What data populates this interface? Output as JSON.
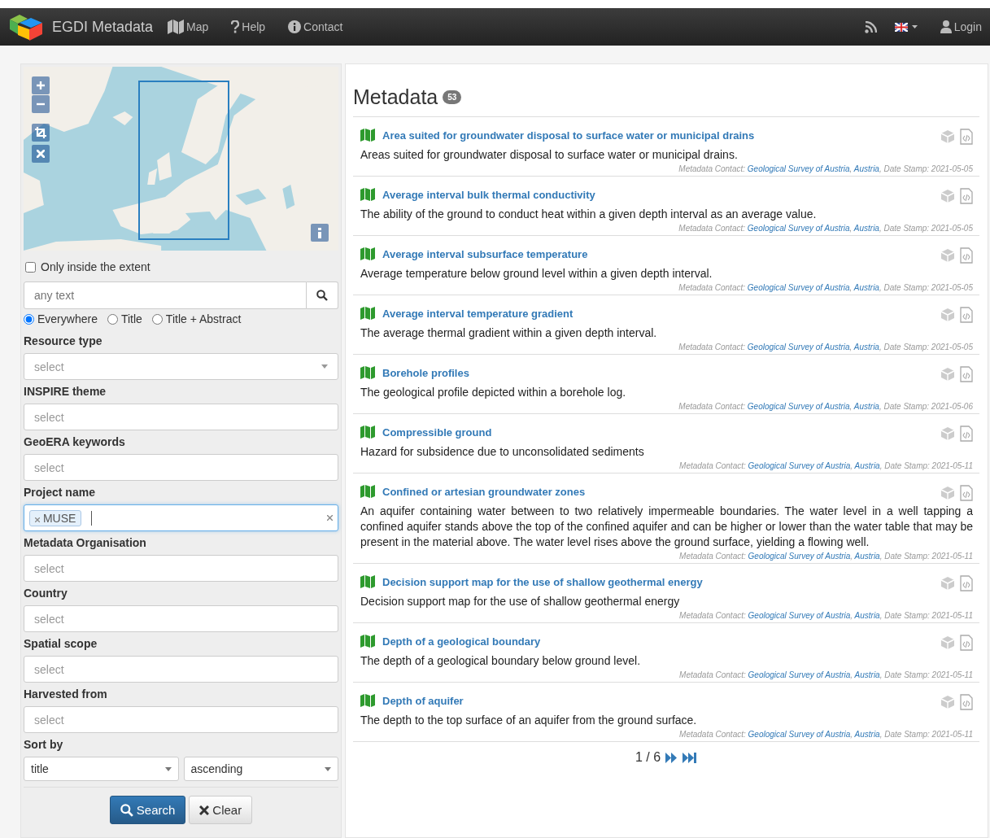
{
  "navbar": {
    "brand": "EGDI Metadata",
    "items": [
      {
        "kind": "map",
        "label": "Map"
      },
      {
        "kind": "help",
        "label": "Help"
      },
      {
        "kind": "info",
        "label": "Contact"
      }
    ],
    "login": "Login"
  },
  "search_panel": {
    "extent": {
      "label": "Only inside the extent",
      "checked": false
    },
    "text_search": {
      "placeholder": "any text"
    },
    "scope": [
      {
        "label": "Everywhere",
        "selected": true
      },
      {
        "label": "Title",
        "selected": false
      },
      {
        "label": "Title + Abstract",
        "selected": false
      }
    ],
    "filters": [
      {
        "label": "Resource type",
        "kind": "dropdown",
        "placeholder": "select"
      },
      {
        "label": "INSPIRE theme",
        "kind": "select",
        "placeholder": "select"
      },
      {
        "label": "GeoERA keywords",
        "kind": "select",
        "placeholder": "select"
      },
      {
        "label": "Project name",
        "kind": "tags",
        "tags": [
          "MUSE"
        ],
        "focused": true
      },
      {
        "label": "Metadata Organisation",
        "kind": "select",
        "placeholder": "select"
      },
      {
        "label": "Country",
        "kind": "select",
        "placeholder": "select"
      },
      {
        "label": "Spatial scope",
        "kind": "select",
        "placeholder": "select"
      },
      {
        "label": "Harvested from",
        "kind": "select",
        "placeholder": "select"
      }
    ],
    "sort": {
      "label": "Sort by",
      "field": "title",
      "order": "ascending"
    },
    "buttons": [
      {
        "kind": "primary",
        "label": "Search"
      },
      {
        "kind": "default",
        "label": "Clear"
      }
    ]
  },
  "results": {
    "title": "Metadata",
    "count": "53",
    "records": [
      {
        "title": "Area suited for groundwater disposal to surface water or municipal drains",
        "description": "Areas suited for groundwater disposal to surface water or municipal drains.",
        "meta": [
          {
            "text": "Metadata Contact: ",
            "link": false
          },
          {
            "text": "Geological Survey of Austria",
            "link": true
          },
          {
            "text": ", ",
            "link": false
          },
          {
            "text": "Austria",
            "link": true
          },
          {
            "text": ", Date Stamp: 2021-05-05",
            "link": false
          }
        ]
      },
      {
        "title": "Average interval bulk thermal conductivity",
        "description": "The ability of the ground to conduct heat within a given depth interval as an average value.",
        "meta": [
          {
            "text": "Metadata Contact: ",
            "link": false
          },
          {
            "text": "Geological Survey of Austria",
            "link": true
          },
          {
            "text": ", ",
            "link": false
          },
          {
            "text": "Austria",
            "link": true
          },
          {
            "text": ", Date Stamp: 2021-05-05",
            "link": false
          }
        ]
      },
      {
        "title": "Average interval subsurface temperature",
        "description": "Average temperature below ground level within a given depth interval.",
        "meta": [
          {
            "text": "Metadata Contact: ",
            "link": false
          },
          {
            "text": "Geological Survey of Austria",
            "link": true
          },
          {
            "text": ", ",
            "link": false
          },
          {
            "text": "Austria",
            "link": true
          },
          {
            "text": ", Date Stamp: 2021-05-05",
            "link": false
          }
        ]
      },
      {
        "title": "Average interval temperature gradient",
        "description": "The average thermal gradient within a given depth interval.",
        "meta": [
          {
            "text": "Metadata Contact: ",
            "link": false
          },
          {
            "text": "Geological Survey of Austria",
            "link": true
          },
          {
            "text": ", ",
            "link": false
          },
          {
            "text": "Austria",
            "link": true
          },
          {
            "text": ", Date Stamp: 2021-05-05",
            "link": false
          }
        ]
      },
      {
        "title": "Borehole profiles",
        "description": "The geological profile depicted within a borehole log.",
        "meta": [
          {
            "text": "Metadata Contact: ",
            "link": false
          },
          {
            "text": "Geological Survey of Austria",
            "link": true
          },
          {
            "text": ", ",
            "link": false
          },
          {
            "text": "Austria",
            "link": true
          },
          {
            "text": ", Date Stamp: 2021-05-06",
            "link": false
          }
        ]
      },
      {
        "title": "Compressible ground",
        "description": "Hazard for subsidence due to unconsolidated sediments",
        "meta": [
          {
            "text": "Metadata Contact: ",
            "link": false
          },
          {
            "text": "Geological Survey of Austria",
            "link": true
          },
          {
            "text": ", ",
            "link": false
          },
          {
            "text": "Austria",
            "link": true
          },
          {
            "text": ", Date Stamp: 2021-05-11",
            "link": false
          }
        ]
      },
      {
        "title": "Confined or artesian groundwater zones",
        "description": "An aquifer containing water between to two relatively impermeable boundaries. The water level in a well tapping a confined aquifer stands above the top of the confined aquifer and can be higher or lower than the water table that may be present in the material above. The water level rises above the ground surface, yielding a flowing well.",
        "meta": [
          {
            "text": "Metadata Contact: ",
            "link": false
          },
          {
            "text": "Geological Survey of Austria",
            "link": true
          },
          {
            "text": ", ",
            "link": false
          },
          {
            "text": "Austria",
            "link": true
          },
          {
            "text": ", Date Stamp: 2021-05-11",
            "link": false
          }
        ]
      },
      {
        "title": "Decision support map for the use of shallow geothermal energy",
        "description": "Decision support map for the use of shallow geothermal energy",
        "meta": [
          {
            "text": "Metadata Contact: ",
            "link": false
          },
          {
            "text": "Geological Survey of Austria",
            "link": true
          },
          {
            "text": ", ",
            "link": false
          },
          {
            "text": "Austria",
            "link": true
          },
          {
            "text": ", Date Stamp: 2021-05-11",
            "link": false
          }
        ]
      },
      {
        "title": "Depth of a geological boundary",
        "description": "The depth of a geological boundary below ground level.",
        "meta": [
          {
            "text": "Metadata Contact: ",
            "link": false
          },
          {
            "text": "Geological Survey of Austria",
            "link": true
          },
          {
            "text": ", ",
            "link": false
          },
          {
            "text": "Austria",
            "link": true
          },
          {
            "text": ", Date Stamp: 2021-05-11",
            "link": false
          }
        ]
      },
      {
        "title": "Depth of aquifer",
        "description": "The depth to the top surface of an aquifer from the ground surface.",
        "meta": [
          {
            "text": "Metadata Contact: ",
            "link": false
          },
          {
            "text": "Geological Survey of Austria",
            "link": true
          },
          {
            "text": ", ",
            "link": false
          },
          {
            "text": "Austria",
            "link": true
          },
          {
            "text": ", Date Stamp: 2021-05-11",
            "link": false
          }
        ]
      }
    ],
    "pagination": "1 / 6"
  }
}
